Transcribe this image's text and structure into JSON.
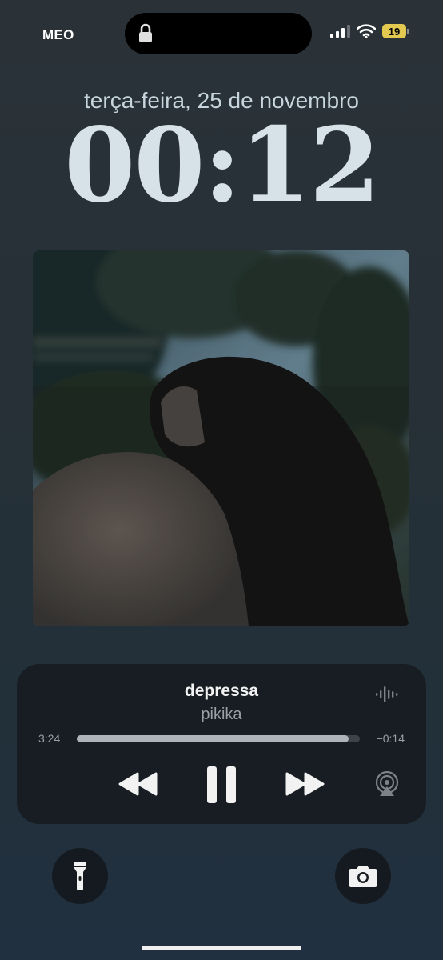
{
  "status_bar": {
    "carrier": "MEO",
    "battery_level": "19",
    "icons": [
      "lock-icon",
      "signal-icon",
      "wifi-icon",
      "battery-icon"
    ],
    "battery_color": "#e3c94f"
  },
  "lock_screen": {
    "date": "terça-feira, 25 de novembro",
    "time": "00:12"
  },
  "now_playing": {
    "title": "depressa",
    "artist": "pikika",
    "elapsed": "3:24",
    "remaining": "−0:14",
    "progress": 0.96,
    "controls": [
      "rewind-icon",
      "pause-icon",
      "fast-forward-icon",
      "airplay-icon",
      "audio-waveform-icon"
    ]
  },
  "quick_actions": [
    "flashlight-icon",
    "camera-icon"
  ],
  "colors": {
    "background": "#263036",
    "clock": "#d7e2e8",
    "player_background": "#14181c"
  }
}
